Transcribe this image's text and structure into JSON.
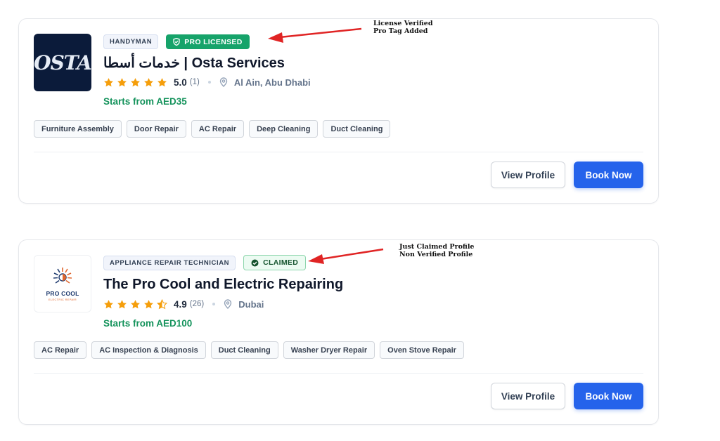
{
  "listings": [
    {
      "logo_text": "OSTA",
      "category": "HANDYMAN",
      "status_badge": "PRO LICENSED",
      "title": "خدمات أسطا | Osta Services",
      "rating": "5.0",
      "rating_count": "(1)",
      "stars": 5,
      "location": "Al Ain, Abu Dhabi",
      "price": "Starts from AED35",
      "tags": [
        "Furniture Assembly",
        "Door Repair",
        "AC Repair",
        "Deep Cleaning",
        "Duct Cleaning"
      ],
      "view_profile_label": "View Profile",
      "book_now_label": "Book Now"
    },
    {
      "logo_text": "PRO COOL",
      "logo_subtext": "ELECTRIC REPAIR",
      "category": "APPLIANCE REPAIR TECHNICIAN",
      "status_badge": "CLAIMED",
      "title": "The Pro Cool and Electric Repairing",
      "rating": "4.9",
      "rating_count": "(26)",
      "stars": 4.5,
      "location": "Dubai",
      "price": "Starts from AED100",
      "tags": [
        "AC Repair",
        "AC Inspection & Diagnosis",
        "Duct Cleaning",
        "Washer Dryer Repair",
        "Oven Stove Repair"
      ],
      "view_profile_label": "View Profile",
      "book_now_label": "Book Now"
    }
  ],
  "annotations": [
    {
      "line1": "License Verified",
      "line2": "Pro Tag Added"
    },
    {
      "line1": "Just Claimed Profile",
      "line2": "Non Verified Profile"
    }
  ],
  "colors": {
    "primary": "#2563eb",
    "pro_green": "#16a36a",
    "price_green": "#15935c",
    "star": "#f59e0b",
    "annotation_arrow": "#e02424"
  },
  "icons": {
    "pro_badge": "shield-check-icon",
    "claimed_badge": "check-circle-icon",
    "location": "map-pin-icon",
    "star": "star-icon"
  }
}
